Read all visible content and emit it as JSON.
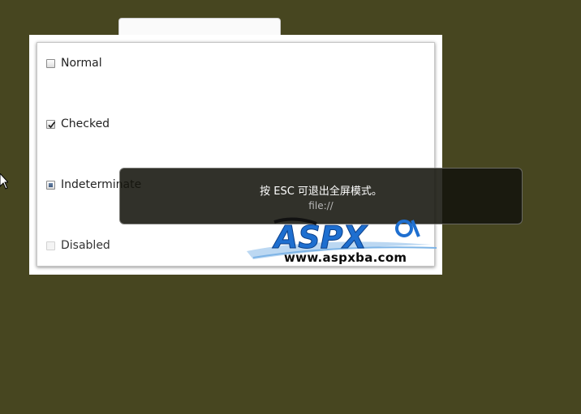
{
  "options": [
    {
      "label": "Normal",
      "state": "unchecked"
    },
    {
      "label": "Checked",
      "state": "checked"
    },
    {
      "label": "Indeterminate",
      "state": "indeterminate"
    },
    {
      "label": "Disabled",
      "state": "disabled"
    }
  ],
  "fullscreen_notice": {
    "message": "按 ESC 可退出全屏模式。",
    "url": "file://"
  },
  "watermark": {
    "url": "www.aspxba.com"
  },
  "colors": {
    "background": "#474620",
    "notice_bg": "#1b1b12",
    "indeterminate_fill": "#4e6a90",
    "watermark_blue": "#1e6fd0"
  },
  "icons": {
    "cursor": "mouse-pointer-icon",
    "check": "checkmark-icon"
  }
}
